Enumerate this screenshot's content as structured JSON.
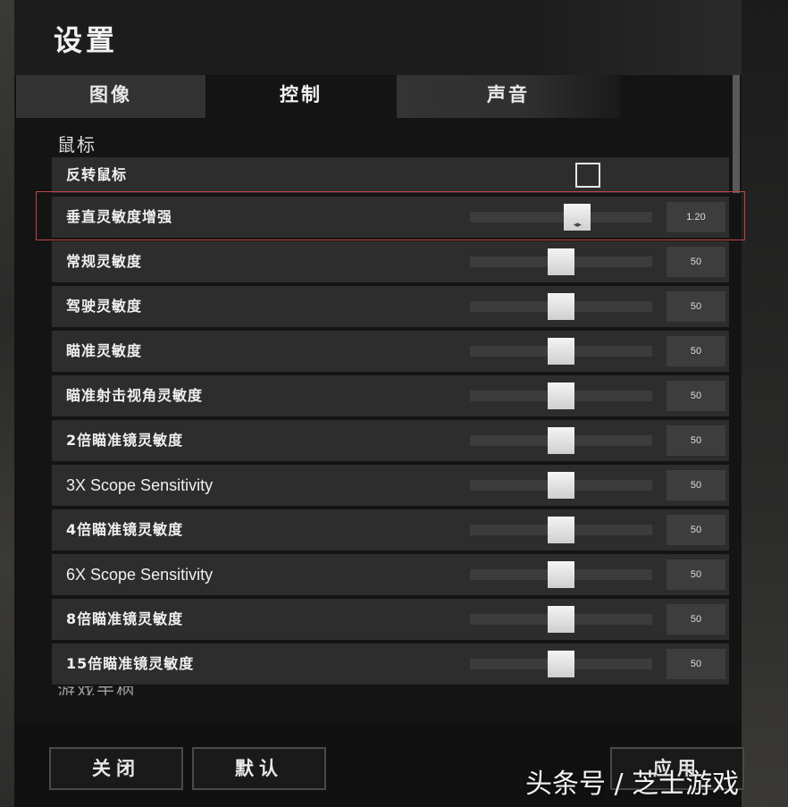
{
  "header": {
    "title": "设置"
  },
  "tabs": [
    {
      "label": "图像",
      "active": false
    },
    {
      "label": "控制",
      "active": true
    },
    {
      "label": "声音",
      "active": false
    }
  ],
  "section": {
    "title": "鼠标",
    "next_title_partial": "游戏手柄"
  },
  "invert_mouse": {
    "label": "反转鼠标",
    "checked": false
  },
  "sliders": [
    {
      "label": "垂直灵敏度增强",
      "value": "1.20",
      "level": 0.59,
      "highlighted": true
    },
    {
      "label": "常规灵敏度",
      "value": "50",
      "level": 0.5
    },
    {
      "label": "驾驶灵敏度",
      "value": "50",
      "level": 0.5
    },
    {
      "label": "瞄准灵敏度",
      "value": "50",
      "level": 0.5
    },
    {
      "label": "瞄准射击视角灵敏度",
      "value": "50",
      "level": 0.5
    },
    {
      "label": "2倍瞄准镜灵敏度",
      "value": "50",
      "level": 0.5
    },
    {
      "label": "3X Scope Sensitivity",
      "value": "50",
      "level": 0.5
    },
    {
      "label": "4倍瞄准镜灵敏度",
      "value": "50",
      "level": 0.5
    },
    {
      "label": "6X Scope Sensitivity",
      "value": "50",
      "level": 0.5
    },
    {
      "label": "8倍瞄准镜灵敏度",
      "value": "50",
      "level": 0.5
    },
    {
      "label": "15倍瞄准镜灵敏度",
      "value": "50",
      "level": 0.5
    }
  ],
  "footer": {
    "close_label": "关闭",
    "default_label": "默认",
    "apply_label": "应用"
  },
  "watermark": "头条号 / 芝士游戏",
  "colors": {
    "highlight_border": "#c04646",
    "row_bg": "#2d2d2d",
    "panel_bg": "#141414"
  }
}
